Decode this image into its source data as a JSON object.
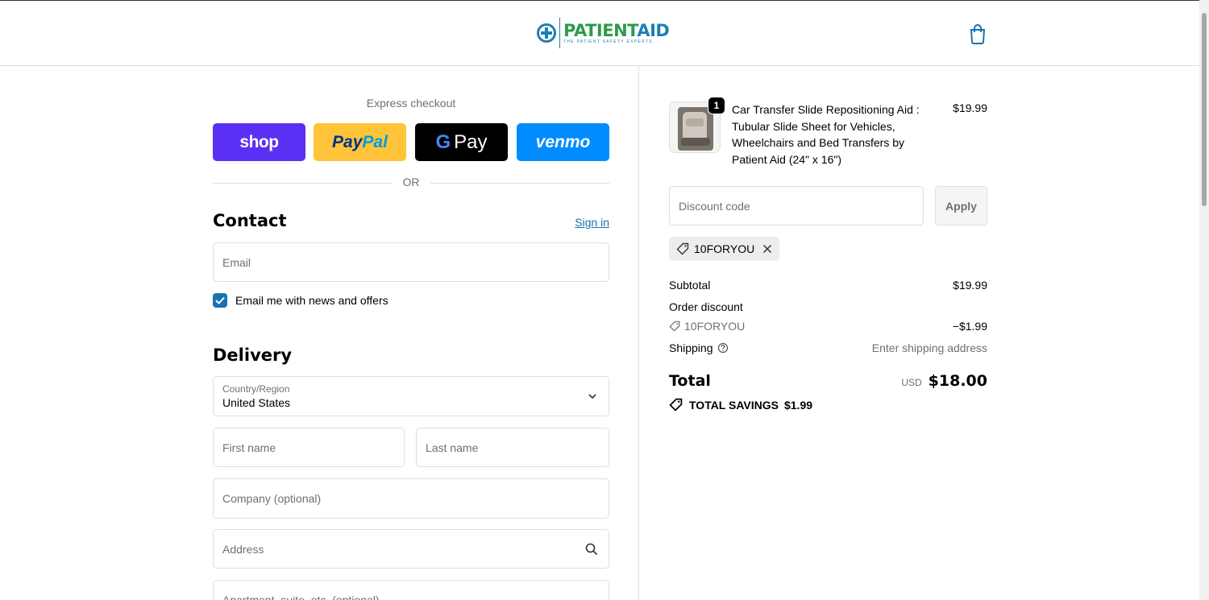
{
  "header": {
    "logo_primary": "PATIENT",
    "logo_secondary": "AID",
    "logo_tagline": "THE PATIENT SAFETY EXPERTS"
  },
  "express": {
    "title": "Express checkout",
    "shop_label": "shop",
    "paypal_label_1": "Pay",
    "paypal_label_2": "Pal",
    "gpay_label": "Pay",
    "venmo_label": "venmo",
    "or_label": "OR"
  },
  "contact": {
    "title": "Contact",
    "sign_in": "Sign in",
    "email_placeholder": "Email",
    "news_label": "Email me with news and offers"
  },
  "delivery": {
    "title": "Delivery",
    "country_label": "Country/Region",
    "country_value": "United States",
    "first_name_placeholder": "First name",
    "last_name_placeholder": "Last name",
    "company_placeholder": "Company (optional)",
    "address_placeholder": "Address",
    "apartment_placeholder": "Apartment, suite, etc. (optional)"
  },
  "summary": {
    "product": {
      "quantity": "1",
      "name": "Car Transfer Slide Repositioning Aid : Tubular Slide Sheet for Vehicles, Wheelchairs and Bed Transfers by Patient Aid (24\" x 16\")",
      "price": "$19.99"
    },
    "discount_placeholder": "Discount code",
    "apply_label": "Apply",
    "applied_code": "10FORYOU",
    "subtotal_label": "Subtotal",
    "subtotal_value": "$19.99",
    "order_discount_label": "Order discount",
    "discount_code": "10FORYOU",
    "discount_value": "−$1.99",
    "shipping_label": "Shipping",
    "shipping_value": "Enter shipping address",
    "total_label": "Total",
    "currency": "USD",
    "total_value": "$18.00",
    "savings_label": "TOTAL SAVINGS",
    "savings_value": "$1.99"
  },
  "colors": {
    "accent": "#1773b0",
    "shop": "#5a31f4",
    "paypal": "#ffc439",
    "gpay": "#000000",
    "venmo": "#008cff"
  }
}
